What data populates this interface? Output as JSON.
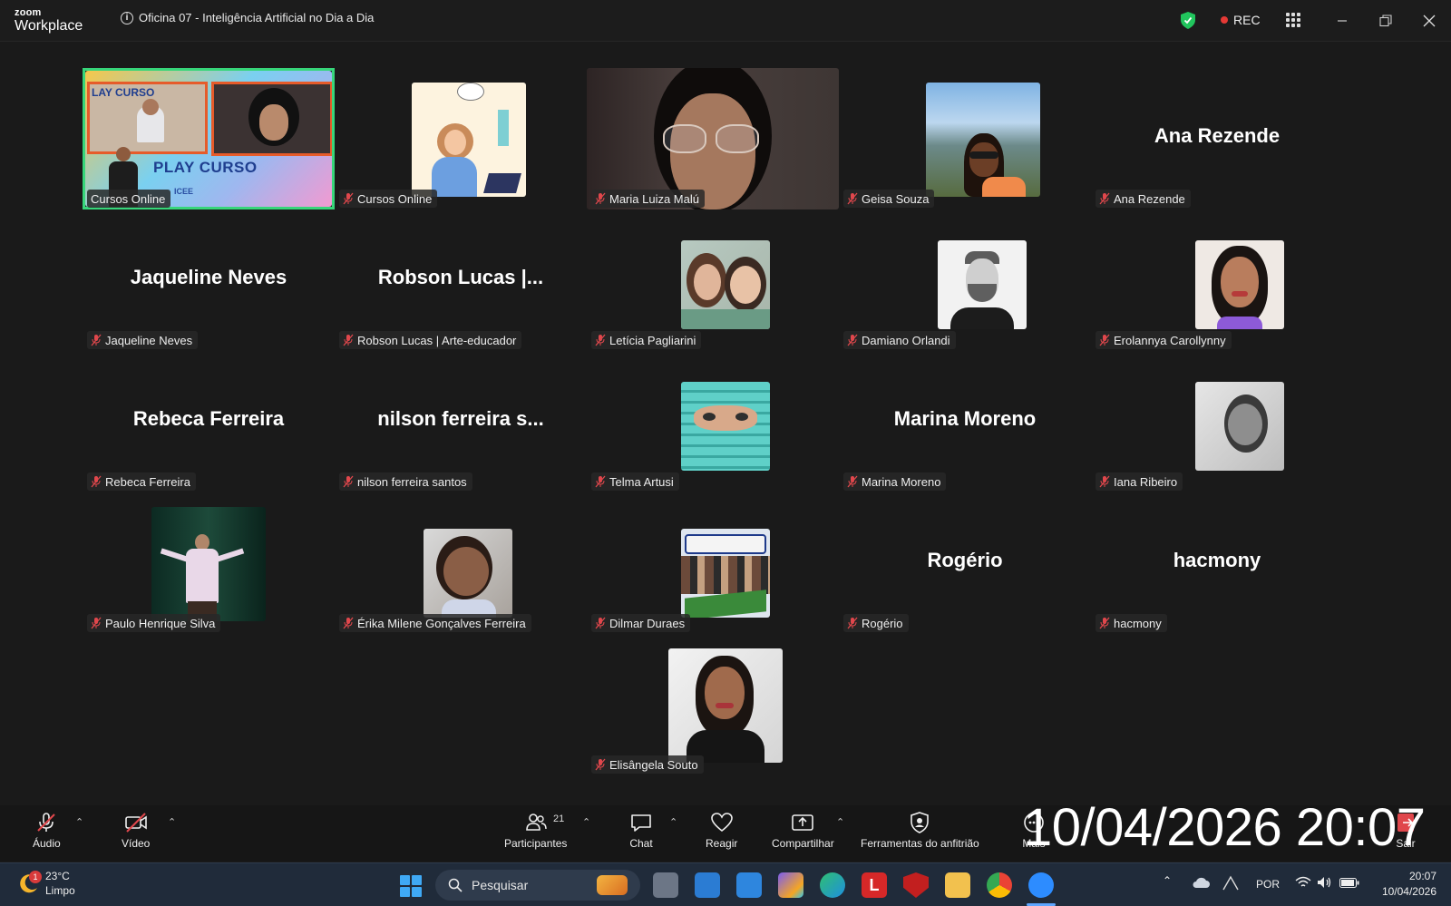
{
  "app": {
    "logo_line1": "zoom",
    "logo_line2": "Workplace",
    "meeting_title": "Oficina 07 - Inteligência Artificial no Dia a Dia",
    "rec_label": "REC"
  },
  "tiles": [
    {
      "label": "Cursos Online",
      "display": "",
      "muted": false
    },
    {
      "label": "Cursos Online",
      "display": "",
      "muted": true
    },
    {
      "label": "Maria Luiza Malú",
      "display": "",
      "muted": true
    },
    {
      "label": "Geisa Souza",
      "display": "",
      "muted": true
    },
    {
      "label": "Ana Rezende",
      "display": "Ana Rezende",
      "muted": true
    },
    {
      "label": "Jaqueline Neves",
      "display": "Jaqueline Neves",
      "muted": true
    },
    {
      "label": "Robson Lucas | Arte-educador",
      "display": "Robson Lucas |...",
      "muted": true
    },
    {
      "label": "Letícia Pagliarini",
      "display": "",
      "muted": true
    },
    {
      "label": "Damiano Orlandi",
      "display": "",
      "muted": true
    },
    {
      "label": "Erolannya Carollynny",
      "display": "",
      "muted": true
    },
    {
      "label": "Rebeca Ferreira",
      "display": "Rebeca Ferreira",
      "muted": true
    },
    {
      "label": "nilson ferreira santos",
      "display": "nilson ferreira s...",
      "muted": true
    },
    {
      "label": "Telma Artusi",
      "display": "",
      "muted": true
    },
    {
      "label": "Marina Moreno",
      "display": "Marina Moreno",
      "muted": true
    },
    {
      "label": "Iana Ribeiro",
      "display": "",
      "muted": true
    },
    {
      "label": "Paulo Henrique Silva",
      "display": "",
      "muted": true
    },
    {
      "label": "Érika Milene Gonçalves Ferreira",
      "display": "",
      "muted": true
    },
    {
      "label": "Dilmar Duraes",
      "display": "",
      "muted": true
    },
    {
      "label": "Rogério",
      "display": "Rogério",
      "muted": true
    },
    {
      "label": "hacmony",
      "display": "hacmony",
      "muted": true
    },
    {
      "label": "Elisângela Souto",
      "display": "",
      "muted": true
    }
  ],
  "cursos_thumb": {
    "top_text": "LAY CURSO",
    "big_text": "PLAY CURSO",
    "brand": "ICEE"
  },
  "toolbar": {
    "audio": "Áudio",
    "video": "Vídeo",
    "participants": "Participantes",
    "participants_count": "21",
    "chat": "Chat",
    "react": "Reagir",
    "share": "Compartilhar",
    "host_tools": "Ferramentas do anfitrião",
    "more": "Mais",
    "leave": "Sair"
  },
  "overlay_timestamp": "10/04/2026 20:07",
  "taskbar": {
    "weather_temp": "23°C",
    "weather_desc": "Limpo",
    "weather_badge": "1",
    "search_placeholder": "Pesquisar",
    "language": "POR",
    "clock_time": "20:07",
    "clock_date": "10/04/2026"
  },
  "colors": {
    "active_speaker": "#37d67a",
    "rec": "#e53935",
    "shield": "#21c55d",
    "mute": "#e0474c"
  }
}
